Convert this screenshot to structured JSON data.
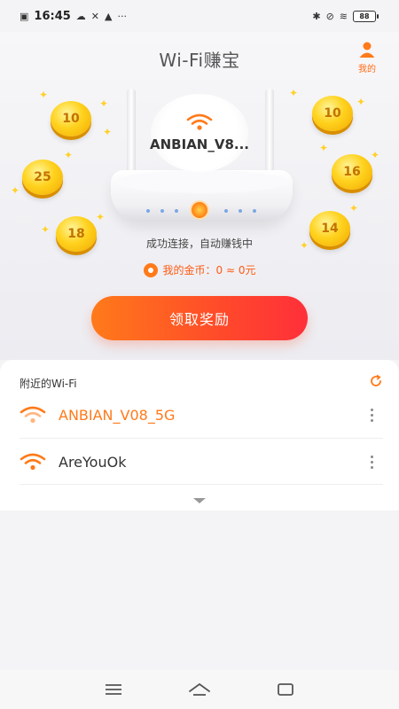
{
  "status_bar": {
    "time": "16:45",
    "battery": "88"
  },
  "header": {
    "title": "Wi-Fi赚宝",
    "me_label": "我的"
  },
  "connected": {
    "ssid_display": "ANBIAN_V8...",
    "status_message": "成功连接，自动赚钱中",
    "gold_label": "我的金币：0 ≈ 0元"
  },
  "coins": [
    {
      "value": "10"
    },
    {
      "value": "25"
    },
    {
      "value": "18"
    },
    {
      "value": "10"
    },
    {
      "value": "16"
    },
    {
      "value": "14"
    }
  ],
  "claim_button": "领取奖励",
  "nearby": {
    "header": "附近的Wi-Fi",
    "networks": [
      {
        "name": "ANBIAN_V08_5G",
        "color": "#ff7a1a"
      },
      {
        "name": "AreYouOk",
        "color": "#333333"
      }
    ]
  },
  "colors": {
    "accent": "#ff6a13",
    "button_gradient_start": "#ff7a1a",
    "button_gradient_end": "#ff2f3a",
    "coin": "#ffd21e"
  }
}
